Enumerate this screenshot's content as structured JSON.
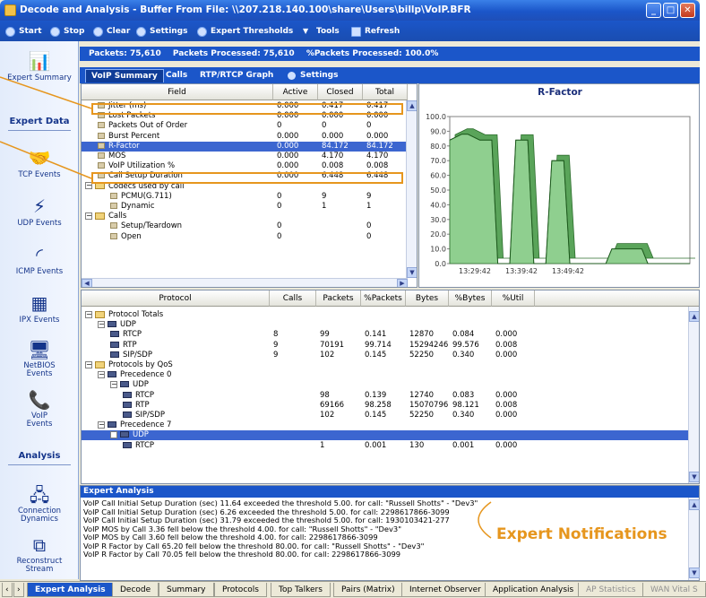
{
  "window": {
    "title": "Decode and Analysis - Buffer From File:  \\\\207.218.140.100\\share\\Users\\billp\\VoIP.BFR"
  },
  "toolbar": [
    "Start",
    "Stop",
    "Clear",
    "Settings",
    "Expert Thresholds",
    "Tools",
    "Refresh"
  ],
  "sidebar": {
    "items": [
      "Expert Summary",
      "TCP Events",
      "UDP Events",
      "ICMP Events",
      "IPX Events",
      "NetBIOS Events",
      "VoIP Events",
      "Connection Dynamics",
      "Reconstruct Stream"
    ],
    "headers": [
      "Expert Data",
      "Analysis"
    ]
  },
  "info": {
    "packets": "Packets: 75,610",
    "processed": "Packets Processed: 75,610",
    "pct": "%Packets Processed: 100.0%"
  },
  "subtabs": [
    "VoIP Summary",
    "Calls",
    "RTP/RTCP Graph",
    "Settings"
  ],
  "summary_table": {
    "headers": [
      "Field",
      "Active",
      "Closed",
      "Total"
    ],
    "rows": [
      {
        "field": "Jitter (ms)",
        "active": "0.000",
        "closed": "0.417",
        "total": "0.417"
      },
      {
        "field": "Lost Packets",
        "active": "0.000",
        "closed": "0.000",
        "total": "0.000"
      },
      {
        "field": "Packets Out of Order",
        "active": "0",
        "closed": "0",
        "total": "0"
      },
      {
        "field": "Burst Percent",
        "active": "0.000",
        "closed": "0.000",
        "total": "0.000"
      },
      {
        "field": "R-Factor",
        "active": "0.000",
        "closed": "84.172",
        "total": "84.172"
      },
      {
        "field": "MOS",
        "active": "0.000",
        "closed": "4.170",
        "total": "4.170"
      },
      {
        "field": "VoIP Utilization %",
        "active": "0.000",
        "closed": "0.008",
        "total": "0.008"
      },
      {
        "field": "Call Setup Duration",
        "active": "0.000",
        "closed": "6.448",
        "total": "6.448"
      },
      {
        "field": "Codecs used by call",
        "active": "",
        "closed": "",
        "total": ""
      },
      {
        "field": "PCMU(G.711)",
        "active": "0",
        "closed": "9",
        "total": "9"
      },
      {
        "field": "Dynamic",
        "active": "0",
        "closed": "1",
        "total": "1"
      },
      {
        "field": "Calls",
        "active": "",
        "closed": "",
        "total": ""
      },
      {
        "field": "Setup/Teardown",
        "active": "0",
        "closed": "",
        "total": "0"
      },
      {
        "field": "Open",
        "active": "0",
        "closed": "",
        "total": "0"
      }
    ]
  },
  "chart_data": {
    "type": "area",
    "title": "R-Factor",
    "ylim": [
      0,
      100
    ],
    "yticks": [
      "0.0",
      "10.0",
      "20.0",
      "30.0",
      "40.0",
      "50.0",
      "60.0",
      "70.0",
      "80.0",
      "90.0",
      "100.0"
    ],
    "xticks": [
      "13:29:42",
      "13:39:42",
      "13:49:42"
    ],
    "x": [
      0,
      1,
      2,
      3,
      4,
      5,
      6,
      7,
      8,
      9,
      10,
      11,
      12,
      13,
      14,
      15,
      16,
      17,
      18,
      19,
      20,
      21,
      22,
      23,
      24,
      25,
      26,
      27,
      28,
      29,
      30,
      31,
      32,
      33,
      34,
      35,
      36,
      37,
      38,
      39,
      40
    ],
    "values": [
      84,
      86,
      88,
      88,
      86,
      84,
      84,
      84,
      0,
      0,
      0,
      84,
      84,
      84,
      0,
      0,
      0,
      70,
      70,
      70,
      0,
      0,
      0,
      0,
      0,
      0,
      0,
      10,
      10,
      10,
      10,
      10,
      10,
      0,
      0,
      0,
      0,
      0,
      0,
      0,
      0
    ]
  },
  "protocol_table": {
    "headers": [
      "Protocol",
      "Calls",
      "Packets",
      "%Packets",
      "Bytes",
      "%Bytes",
      "%Util"
    ],
    "rows": [
      {
        "label": "Protocol Totals",
        "calls": "",
        "packets": "",
        "pct_packets": "",
        "bytes": "",
        "pct_bytes": "",
        "util": ""
      },
      {
        "label": "UDP",
        "calls": "",
        "packets": "",
        "pct_packets": "",
        "bytes": "",
        "pct_bytes": "",
        "util": ""
      },
      {
        "label": "RTCP",
        "calls": "8",
        "packets": "99",
        "pct_packets": "0.141",
        "bytes": "12870",
        "pct_bytes": "0.084",
        "util": "0.000"
      },
      {
        "label": "RTP",
        "calls": "9",
        "packets": "70191",
        "pct_packets": "99.714",
        "bytes": "15294246",
        "pct_bytes": "99.576",
        "util": "0.008"
      },
      {
        "label": "SIP/SDP",
        "calls": "9",
        "packets": "102",
        "pct_packets": "0.145",
        "bytes": "52250",
        "pct_bytes": "0.340",
        "util": "0.000"
      },
      {
        "label": "Protocols by QoS",
        "calls": "",
        "packets": "",
        "pct_packets": "",
        "bytes": "",
        "pct_bytes": "",
        "util": ""
      },
      {
        "label": "Precedence 0",
        "calls": "",
        "packets": "",
        "pct_packets": "",
        "bytes": "",
        "pct_bytes": "",
        "util": ""
      },
      {
        "label": "UDP",
        "calls": "",
        "packets": "",
        "pct_packets": "",
        "bytes": "",
        "pct_bytes": "",
        "util": ""
      },
      {
        "label": "RTCP",
        "calls": "",
        "packets": "98",
        "pct_packets": "0.139",
        "bytes": "12740",
        "pct_bytes": "0.083",
        "util": "0.000"
      },
      {
        "label": "RTP",
        "calls": "",
        "packets": "69166",
        "pct_packets": "98.258",
        "bytes": "15070796",
        "pct_bytes": "98.121",
        "util": "0.008"
      },
      {
        "label": "SIP/SDP",
        "calls": "",
        "packets": "102",
        "pct_packets": "0.145",
        "bytes": "52250",
        "pct_bytes": "0.340",
        "util": "0.000"
      },
      {
        "label": "Precedence 7",
        "calls": "",
        "packets": "",
        "pct_packets": "",
        "bytes": "",
        "pct_bytes": "",
        "util": ""
      },
      {
        "label": "UDP",
        "calls": "",
        "packets": "",
        "pct_packets": "",
        "bytes": "",
        "pct_bytes": "",
        "util": ""
      },
      {
        "label": "RTCP",
        "calls": "",
        "packets": "1",
        "pct_packets": "0.001",
        "bytes": "130",
        "pct_bytes": "0.001",
        "util": "0.000"
      }
    ]
  },
  "expert": {
    "title": "Expert Analysis",
    "lines": [
      "VoIP Call Initial Setup Duration (sec) 11.64 exceeded the threshold 5.00. for call: \"Russell Shotts\" - \"Dev3\"",
      "VoIP Call Initial Setup Duration (sec) 6.26 exceeded the threshold 5.00. for call: 2298617866-3099",
      "VoIP Call Initial Setup Duration (sec) 31.79 exceeded the threshold 5.00. for call: 1930103421-277",
      "VoIP MOS by Call 3.36 fell below the threshold 4.00. for call: \"Russell Shotts\" - \"Dev3\"",
      "VoIP MOS by Call 3.60 fell below the threshold 4.00. for call: 2298617866-3099",
      "VoIP R Factor by Call 65.20 fell below the threshold 80.00. for call: \"Russell Shotts\" - \"Dev3\"",
      "VoIP R Factor by Call 70.05 fell below the threshold 80.00. for call: 2298617866-3099"
    ]
  },
  "annotation": "Expert Notifications",
  "bottom_tabs": [
    "Expert Analysis",
    "Decode",
    "Summary",
    "Protocols",
    "Top Talkers",
    "Pairs (Matrix)",
    "Internet Observer",
    "Application Analysis",
    "AP Statistics",
    "WAN Vital S"
  ],
  "colors": {
    "accent": "#1b56c9",
    "highlight": "#e6961e",
    "bar_fill": "#8fcf8f"
  }
}
